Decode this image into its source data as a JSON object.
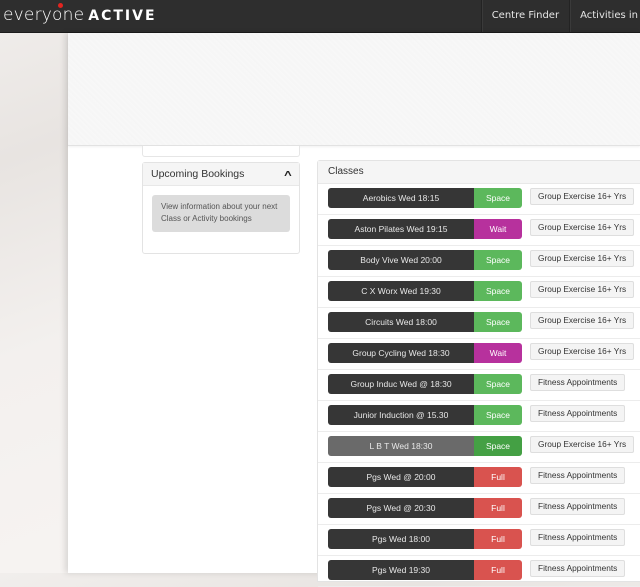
{
  "navbar": {
    "logo_primary": "everyone",
    "logo_secondary": "ACTIVE",
    "items": [
      {
        "label": "Centre Finder"
      },
      {
        "label": "Activities in"
      }
    ]
  },
  "sidebar": {
    "upcoming_bookings": {
      "title": "Upcoming Bookings",
      "toggle_icon": "chevron-up-icon",
      "info_text": "View information about your next Class or Activity bookings"
    }
  },
  "classes": {
    "title": "Classes",
    "status_colors": {
      "Space": "#5cb85c",
      "Wait": "#b7319d",
      "Full": "#d9534f"
    },
    "rows": [
      {
        "name": "Aerobics Wed 18:15",
        "status": "Space",
        "category": "Group Exercise 16+ Yrs"
      },
      {
        "name": "Aston Pilates Wed 19:15",
        "status": "Wait",
        "category": "Group Exercise 16+ Yrs"
      },
      {
        "name": "Body Vive Wed 20:00",
        "status": "Space",
        "category": "Group Exercise 16+ Yrs"
      },
      {
        "name": "C X Worx Wed 19:30",
        "status": "Space",
        "category": "Group Exercise 16+ Yrs"
      },
      {
        "name": "Circuits Wed 18:00",
        "status": "Space",
        "category": "Group Exercise 16+ Yrs"
      },
      {
        "name": "Group Cycling Wed 18:30",
        "status": "Wait",
        "category": "Group Exercise 16+ Yrs"
      },
      {
        "name": "Group Induc Wed @ 18:30",
        "status": "Space",
        "category": "Fitness Appointments"
      },
      {
        "name": "Junior Induction @ 15.30",
        "status": "Space",
        "category": "Fitness Appointments"
      },
      {
        "name": "L B T Wed 18:30",
        "status": "Space",
        "category": "Group Exercise 16+ Yrs",
        "hovered": true
      },
      {
        "name": "Pgs Wed @ 20:00",
        "status": "Full",
        "category": "Fitness Appointments"
      },
      {
        "name": "Pgs Wed @ 20:30",
        "status": "Full",
        "category": "Fitness Appointments"
      },
      {
        "name": "Pgs Wed 18:00",
        "status": "Full",
        "category": "Fitness Appointments"
      },
      {
        "name": "Pgs Wed 19:30",
        "status": "Full",
        "category": "Fitness Appointments"
      }
    ]
  }
}
